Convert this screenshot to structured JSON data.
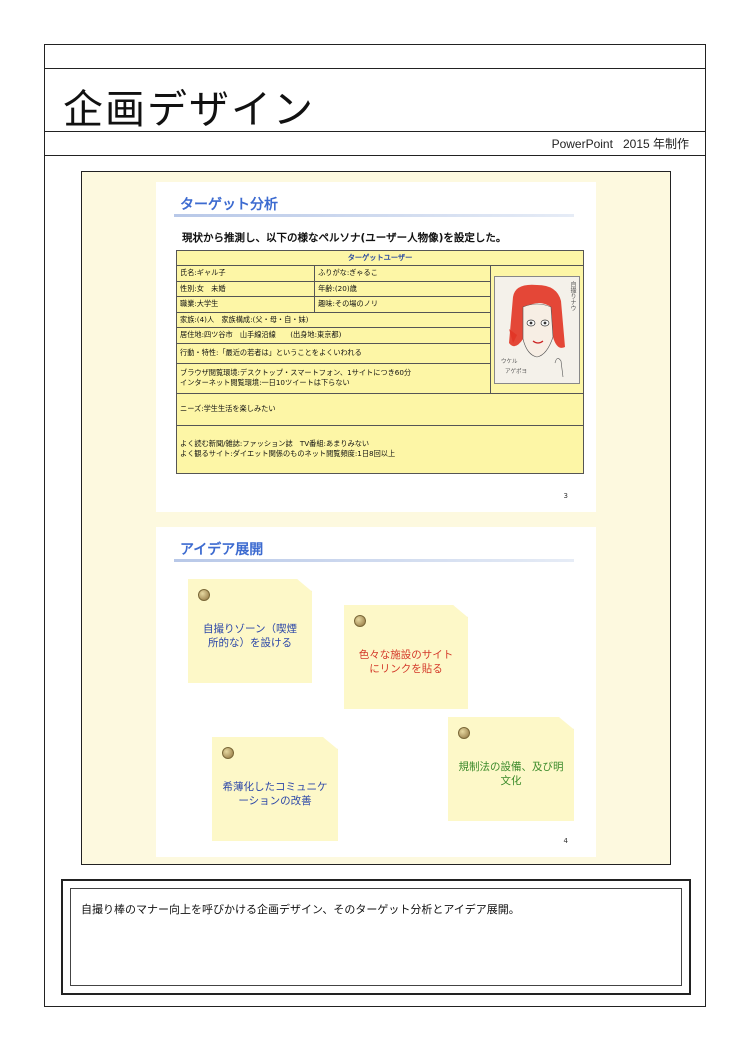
{
  "header": {
    "title": "企画デザイン",
    "software": "PowerPoint",
    "year_label": "2015 年制作"
  },
  "slide1": {
    "title": "ターゲット分析",
    "lead": "現状から推測し、以下の様なペルソナ(ユーザー人物像)を設定した。",
    "table_header": "ターゲットユーザー",
    "name": "氏名:ギャル子",
    "furigana": "ふりがな:ぎゃるこ",
    "gender": "性別:女　未婚",
    "age": "年齢:(20)歳",
    "job": "職業:大学生",
    "hobby": "趣味:その場のノリ",
    "family": "家族:(4)人　家族構成:(父・母・自・妹)",
    "residence": "居住地:四ツ谷市　山手線沿線　　(出身地:東京都)",
    "behavior": "行動・特性:「最近の若者は」ということをよくいわれる",
    "browse1": "ブラウザ閲覧環境:デスクトップ・スマートフォン、1サイトにつき60分",
    "browse2": "インターネット閲覧環境:一日10ツイートは下らない",
    "needs": "ニーズ:学生生活を楽しみたい",
    "media1": "よく読む新聞/雑誌:ファッション誌　TV番組:あまりみない",
    "media2": "よく観るサイト:ダイエット関係のものネット閲覧頻度:1日8回以上",
    "photo_text_1": "自撮りナウ",
    "photo_text_2": "ウケル",
    "photo_text_3": "アゲポヨ",
    "page": "3"
  },
  "slide2": {
    "title": "アイデア展開",
    "notes": [
      {
        "text": "自撮りゾーン（喫煙所的な）を設ける",
        "color": "#2b46a8"
      },
      {
        "text": "色々な施設のサイトにリンクを貼る",
        "color": "#d43a2a"
      },
      {
        "text": "希薄化したコミュニケーションの改善",
        "color": "#2b46a8"
      },
      {
        "text": "規制法の設備、及び明文化",
        "color": "#3b8a2a"
      }
    ],
    "page": "4"
  },
  "caption": "自撮り棒のマナー向上を呼びかける企画デザイン、そのターゲット分析とアイデア展開。"
}
